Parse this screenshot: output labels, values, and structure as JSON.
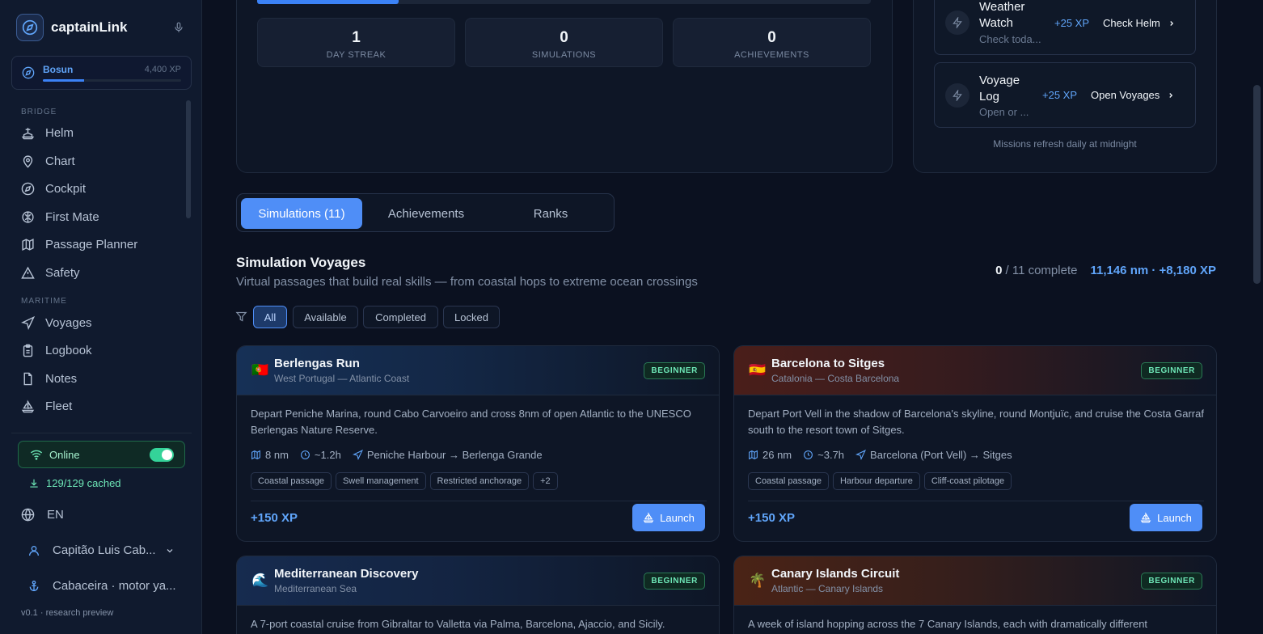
{
  "brand": {
    "name": "captainLink"
  },
  "rank": {
    "name": "Bosun",
    "xp": "4,400 XP",
    "progress": 0.3
  },
  "nav": {
    "bridge_label": "BRIDGE",
    "bridge": [
      {
        "label": "Helm",
        "icon": "ship-wheel-icon"
      },
      {
        "label": "Chart",
        "icon": "map-pin-icon"
      },
      {
        "label": "Cockpit",
        "icon": "compass-icon"
      },
      {
        "label": "First Mate",
        "icon": "brain-icon"
      },
      {
        "label": "Passage Planner",
        "icon": "map-icon"
      },
      {
        "label": "Safety",
        "icon": "warning-icon"
      }
    ],
    "maritime_label": "MARITIME",
    "maritime": [
      {
        "label": "Voyages",
        "icon": "navigation-icon"
      },
      {
        "label": "Logbook",
        "icon": "clipboard-icon"
      },
      {
        "label": "Notes",
        "icon": "file-icon"
      },
      {
        "label": "Fleet",
        "icon": "sailboat-icon"
      }
    ]
  },
  "status": {
    "online": "Online",
    "cached": "129/129 cached",
    "online_toggle": true
  },
  "language": "EN",
  "user": {
    "name": "Capitão Luis Cab...",
    "vessel": "Cabaceira · motor ya..."
  },
  "version": "v0.1 · research preview",
  "stats": {
    "top_progress": 0.23,
    "items": [
      {
        "value": "1",
        "label": "DAY STREAK"
      },
      {
        "value": "0",
        "label": "SIMULATIONS"
      },
      {
        "value": "0",
        "label": "ACHIEVEMENTS"
      }
    ]
  },
  "missions": {
    "items": [
      {
        "title": "Weather Watch",
        "subtitle": "Check toda...",
        "xp": "+25 XP",
        "action": "Check Helm"
      },
      {
        "title": "Voyage Log",
        "subtitle": "Open or ...",
        "xp": "+25 XP",
        "action": "Open Voyages"
      }
    ],
    "footer": "Missions refresh daily at midnight"
  },
  "tabs": [
    {
      "label": "Simulations (11)",
      "active": true
    },
    {
      "label": "Achievements",
      "active": false
    },
    {
      "label": "Ranks",
      "active": false
    }
  ],
  "section": {
    "title": "Simulation Voyages",
    "subtitle": "Virtual passages that build real skills — from coastal hops to extreme ocean crossings",
    "complete_count": "0",
    "complete_of": "/ 11 complete",
    "totals": "11,146 nm · +8,180 XP"
  },
  "filters": [
    {
      "label": "All",
      "active": true
    },
    {
      "label": "Available",
      "active": false
    },
    {
      "label": "Completed",
      "active": false
    },
    {
      "label": "Locked",
      "active": false
    }
  ],
  "voyages": [
    {
      "flag": "🇵🇹",
      "title": "Berlengas Run",
      "region": "West Portugal — Atlantic Coast",
      "level": "BEGINNER",
      "description": "Depart Peniche Marina, round Cabo Carvoeiro and cross 8nm of open Atlantic to the UNESCO Berlengas Nature Reserve.",
      "distance": "8 nm",
      "duration": "~1.2h",
      "route": "Peniche Harbour → Berlenga Grande",
      "tags": [
        "Coastal passage",
        "Swell management",
        "Restricted anchorage",
        "+2"
      ],
      "xp": "+150 XP",
      "launch": "Launch",
      "accent": "#163056"
    },
    {
      "flag": "🇪🇸",
      "title": "Barcelona to Sitges",
      "region": "Catalonia — Costa Barcelona",
      "level": "BEGINNER",
      "description": "Depart Port Vell in the shadow of Barcelona's skyline, round Montjuïc, and cruise the Costa Garraf south to the resort town of Sitges.",
      "distance": "26 nm",
      "duration": "~3.7h",
      "route": "Barcelona (Port Vell) → Sitges",
      "tags": [
        "Coastal passage",
        "Harbour departure",
        "Cliff-coast pilotage"
      ],
      "xp": "+150 XP",
      "launch": "Launch",
      "accent": "#4a1e1a"
    },
    {
      "flag": "🌊",
      "title": "Mediterranean Discovery",
      "region": "Mediterranean Sea",
      "level": "BEGINNER",
      "description": "A 7-port coastal cruise from Gibraltar to Valletta via Palma, Barcelona, Ajaccio, and Sicily.",
      "accent": "#162b4f"
    },
    {
      "flag": "🌴",
      "title": "Canary Islands Circuit",
      "region": "Atlantic — Canary Islands",
      "level": "BEGINNER",
      "description": "A week of island hopping across the 7 Canary Islands, each with dramatically different",
      "accent": "#4a2316"
    }
  ]
}
